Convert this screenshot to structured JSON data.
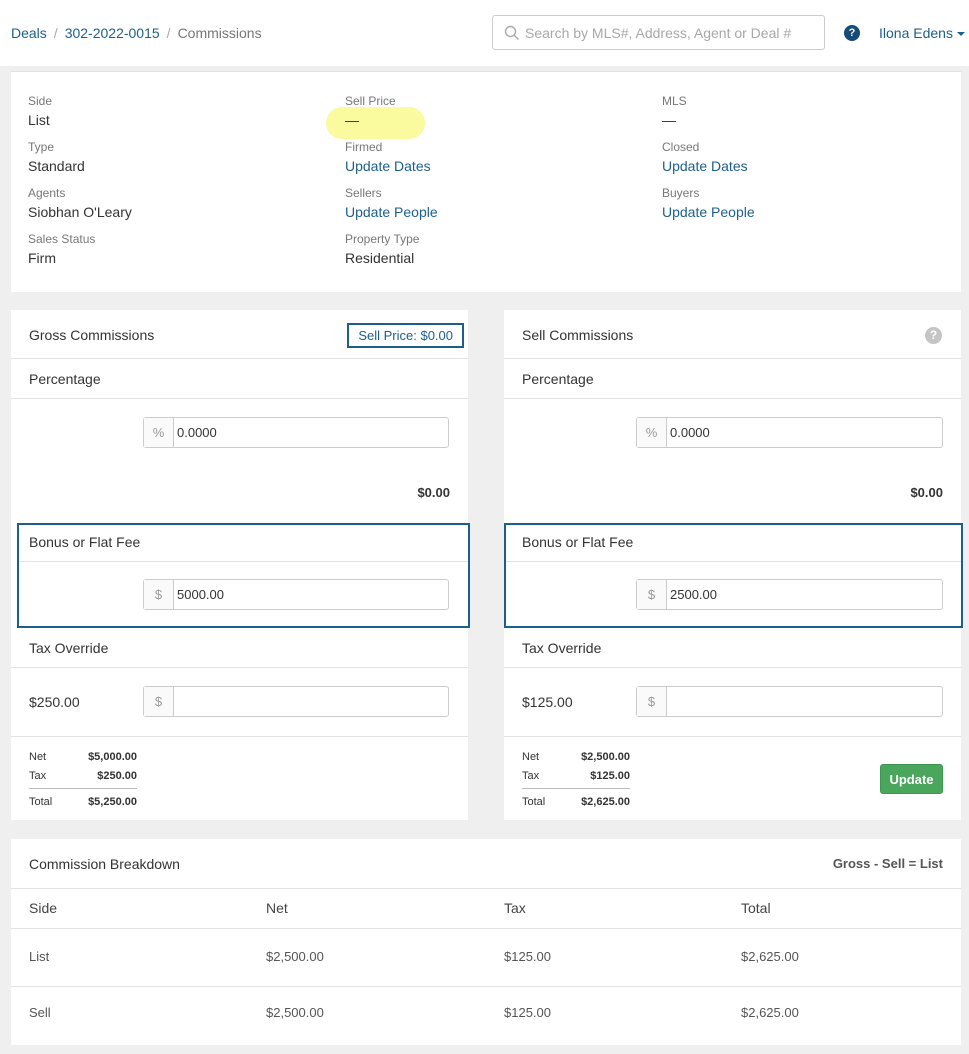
{
  "breadcrumb": {
    "deals": "Deals",
    "deal_number": "302-2022-0015",
    "current": "Commissions",
    "separator": "/"
  },
  "search": {
    "placeholder": "Search by MLS#, Address, Agent or Deal #"
  },
  "header": {
    "help": "?",
    "user_name": "Ilona Edens"
  },
  "info": {
    "side_label": "Side",
    "side_value": "List",
    "type_label": "Type",
    "type_value": "Standard",
    "agents_label": "Agents",
    "agents_value": "Siobhan O'Leary",
    "sales_status_label": "Sales Status",
    "sales_status_value": "Firm",
    "sell_price_label": "Sell Price",
    "sell_price_value": "—",
    "firmed_label": "Firmed",
    "firmed_value": "Update Dates",
    "sellers_label": "Sellers",
    "sellers_value": "Update People",
    "property_type_label": "Property Type",
    "property_type_value": "Residential",
    "mls_label": "MLS",
    "mls_value": "—",
    "closed_label": "Closed",
    "closed_value": "Update Dates",
    "buyers_label": "Buyers",
    "buyers_value": "Update People"
  },
  "gross": {
    "title": "Gross Commissions",
    "sell_price_badge": "Sell Price: $0.00",
    "percentage_label": "Percentage",
    "percent_addon": "%",
    "percent_value": "0.0000",
    "percent_amount": "$0.00",
    "bonus_label": "Bonus or Flat Fee",
    "dollar_addon": "$",
    "bonus_value": "5000.00",
    "tax_override_label": "Tax Override",
    "tax_amount": "$250.00",
    "tax_override_value": "",
    "net_label": "Net",
    "net_value": "$5,000.00",
    "tax_label": "Tax",
    "tax_value": "$250.00",
    "total_label": "Total",
    "total_value": "$5,250.00"
  },
  "sell": {
    "title": "Sell Commissions",
    "help": "?",
    "percentage_label": "Percentage",
    "percent_addon": "%",
    "percent_value": "0.0000",
    "percent_amount": "$0.00",
    "bonus_label": "Bonus or Flat Fee",
    "dollar_addon": "$",
    "bonus_value": "2500.00",
    "tax_override_label": "Tax Override",
    "tax_amount": "$125.00",
    "tax_override_value": "",
    "net_label": "Net",
    "net_value": "$2,500.00",
    "tax_label": "Tax",
    "tax_value": "$125.00",
    "total_label": "Total",
    "total_value": "$2,625.00",
    "update_label": "Update"
  },
  "breakdown": {
    "title": "Commission Breakdown",
    "formula": "Gross - Sell = List",
    "columns": [
      "Side",
      "Net",
      "Tax",
      "Total"
    ],
    "rows": [
      [
        "List",
        "$2,500.00",
        "$125.00",
        "$2,625.00"
      ],
      [
        "Sell",
        "$2,500.00",
        "$125.00",
        "$2,625.00"
      ]
    ]
  },
  "colors": {
    "link": "#1d5f8c",
    "accent_border": "#1d5f8c",
    "update_button": "#4aa55d",
    "highlight": "#fafa9e"
  }
}
